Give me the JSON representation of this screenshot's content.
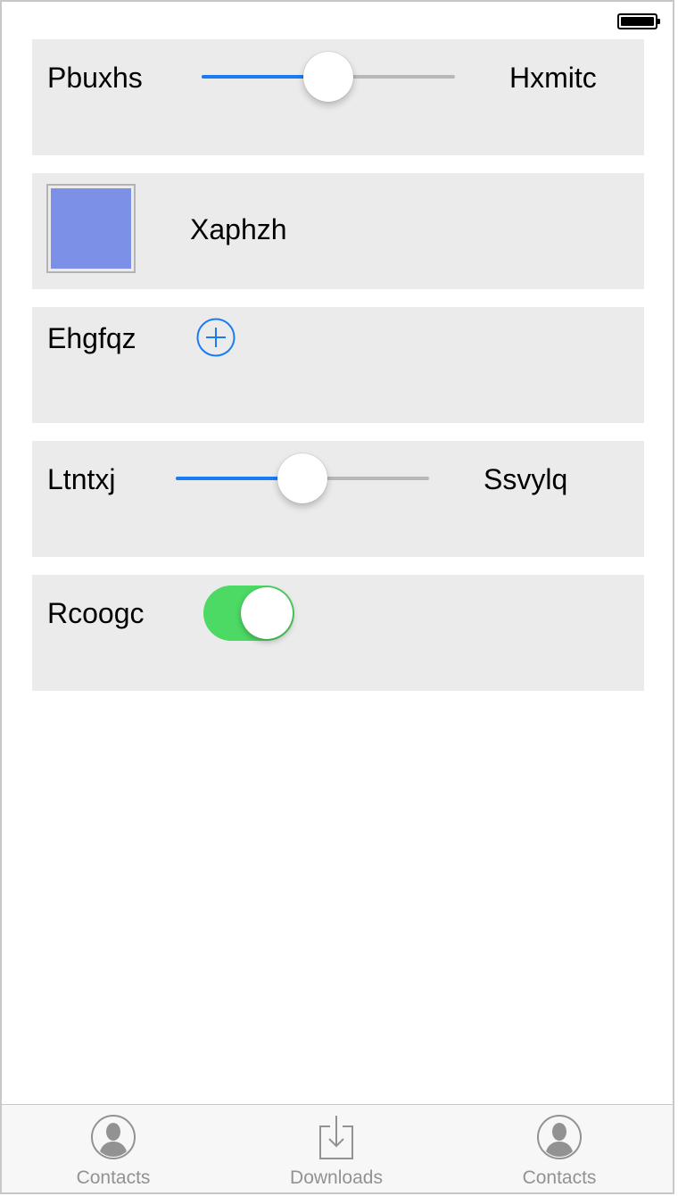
{
  "status_bar": {
    "battery": "battery-icon"
  },
  "rows": {
    "slider1": {
      "left_label": "Pbuxhs",
      "right_label": "Hxmitc",
      "value": 0.5
    },
    "color": {
      "label": "Xaphzh",
      "swatch_color": "#7b90e6"
    },
    "add": {
      "label": "Ehgfqz",
      "icon": "add-circle-icon",
      "accent": "#1a7cf5"
    },
    "slider2": {
      "left_label": "Ltntxj",
      "right_label": "Ssvylq",
      "value": 0.5
    },
    "toggle": {
      "label": "Rcoogc",
      "on": true,
      "on_color": "#4cd964"
    }
  },
  "tabbar": {
    "tabs": [
      {
        "label": "Contacts",
        "icon": "contact-icon"
      },
      {
        "label": "Downloads",
        "icon": "downloads-icon"
      },
      {
        "label": "Contacts",
        "icon": "contact-icon"
      }
    ]
  }
}
